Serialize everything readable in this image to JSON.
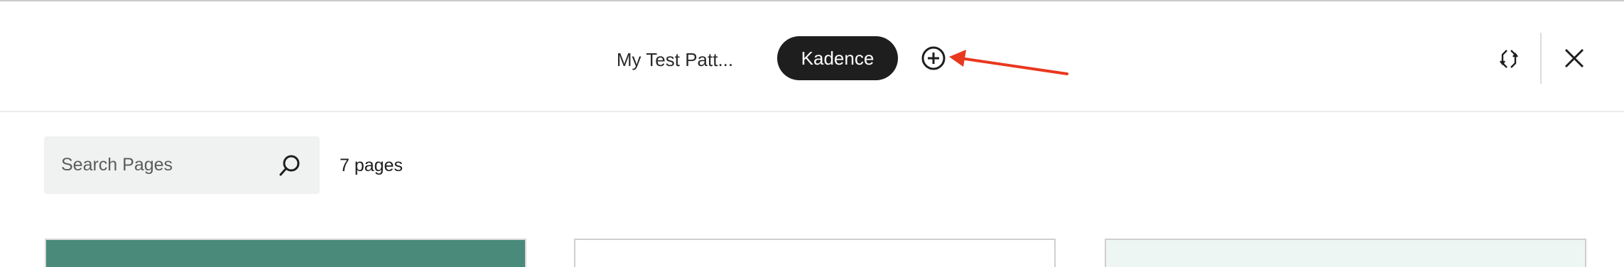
{
  "header": {
    "tabs": [
      {
        "label": "My Test Patt..."
      },
      {
        "label": "Kadence"
      }
    ]
  },
  "icons": {
    "add": "add-circle-icon",
    "annotation": "red-arrow-annotation",
    "swap": "swap-arrows-icon",
    "close": "close-icon",
    "search": "search-icon"
  },
  "search": {
    "placeholder": "Search Pages",
    "value": ""
  },
  "results": {
    "count_label": "7 pages"
  },
  "colors": {
    "active_tab_bg": "#1e1e1e",
    "annotation_red": "#e8381f",
    "card1_bg": "#4a8a7a",
    "card3_bg": "#eef6f3"
  }
}
